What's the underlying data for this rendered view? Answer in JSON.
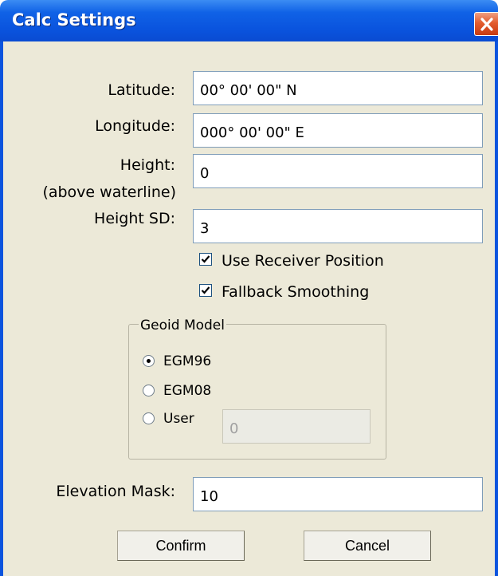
{
  "window": {
    "title": "Calc Settings"
  },
  "fields": {
    "latitude": {
      "label": "Latitude:",
      "value": "00° 00' 00\" N"
    },
    "longitude": {
      "label": "Longitude:",
      "value": "000° 00' 00\" E"
    },
    "height": {
      "label": "Height:",
      "sublabel": "(above waterline)",
      "value": "0"
    },
    "height_sd": {
      "label": "Height SD:",
      "value": "3"
    }
  },
  "checkboxes": {
    "use_receiver_position": {
      "label": "Use Receiver Position",
      "checked": true
    },
    "fallback_smoothing": {
      "label": "Fallback Smoothing",
      "checked": true
    }
  },
  "geoid": {
    "title": "Geoid Model",
    "options": [
      {
        "label": "EGM96",
        "selected": true
      },
      {
        "label": "EGM08",
        "selected": false
      },
      {
        "label": "User",
        "selected": false
      }
    ],
    "user_value": "0"
  },
  "elevation_mask": {
    "label": "Elevation Mask:",
    "value": "10"
  },
  "buttons": {
    "confirm": "Confirm",
    "cancel": "Cancel"
  }
}
